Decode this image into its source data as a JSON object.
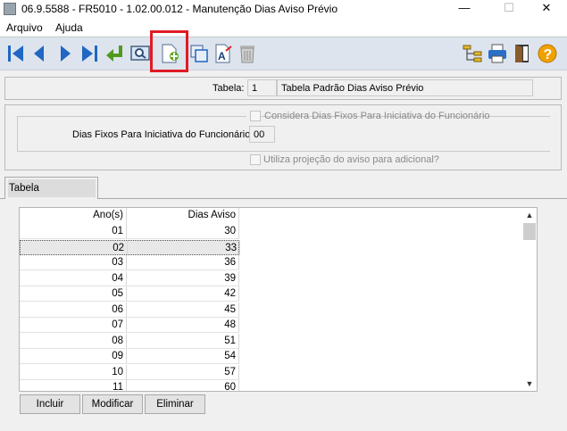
{
  "window": {
    "title": "06.9.5588 - FR5010 - 1.02.00.012 - Manutenção Dias Aviso Prévio",
    "minimize": "—",
    "maximize": "☐",
    "close": "✕"
  },
  "menu": [
    "Arquivo",
    "Ajuda"
  ],
  "toolbar": {
    "icons": [
      "first-icon",
      "previous-icon",
      "next-icon",
      "last-icon",
      "goto-icon",
      "search-icon",
      "add-icon",
      "copy-icon",
      "edit-icon",
      "delete-icon",
      "tree-icon",
      "print-icon",
      "exit-icon",
      "help-icon"
    ],
    "help_label": "?"
  },
  "tabela": {
    "label": "Tabela:",
    "code": "1",
    "description": "Tabela Padrão Dias Aviso Prévio"
  },
  "dias": {
    "considera_label": "Considera Dias Fixos Para Iniciativa do Funcionário",
    "fixos_label": "Dias Fixos Para Iniciativa do Funcionário:",
    "fixos_value": "00",
    "projecao_label": "Utiliza projeção do aviso para adicional?"
  },
  "tab": {
    "label": "Tabela"
  },
  "grid": {
    "headers": [
      "Ano(s)",
      "Dias Aviso"
    ],
    "rows": [
      [
        "01",
        "30"
      ],
      [
        "02",
        "33"
      ],
      [
        "03",
        "36"
      ],
      [
        "04",
        "39"
      ],
      [
        "05",
        "42"
      ],
      [
        "06",
        "45"
      ],
      [
        "07",
        "48"
      ],
      [
        "08",
        "51"
      ],
      [
        "09",
        "54"
      ],
      [
        "10",
        "57"
      ],
      [
        "11",
        "60"
      ]
    ],
    "selected_row": 1
  },
  "scroll": {
    "up": "▲",
    "down": "▼"
  },
  "buttons": {
    "incluir": "Incluir",
    "modificar": "Modificar",
    "eliminar": "Eliminar"
  }
}
